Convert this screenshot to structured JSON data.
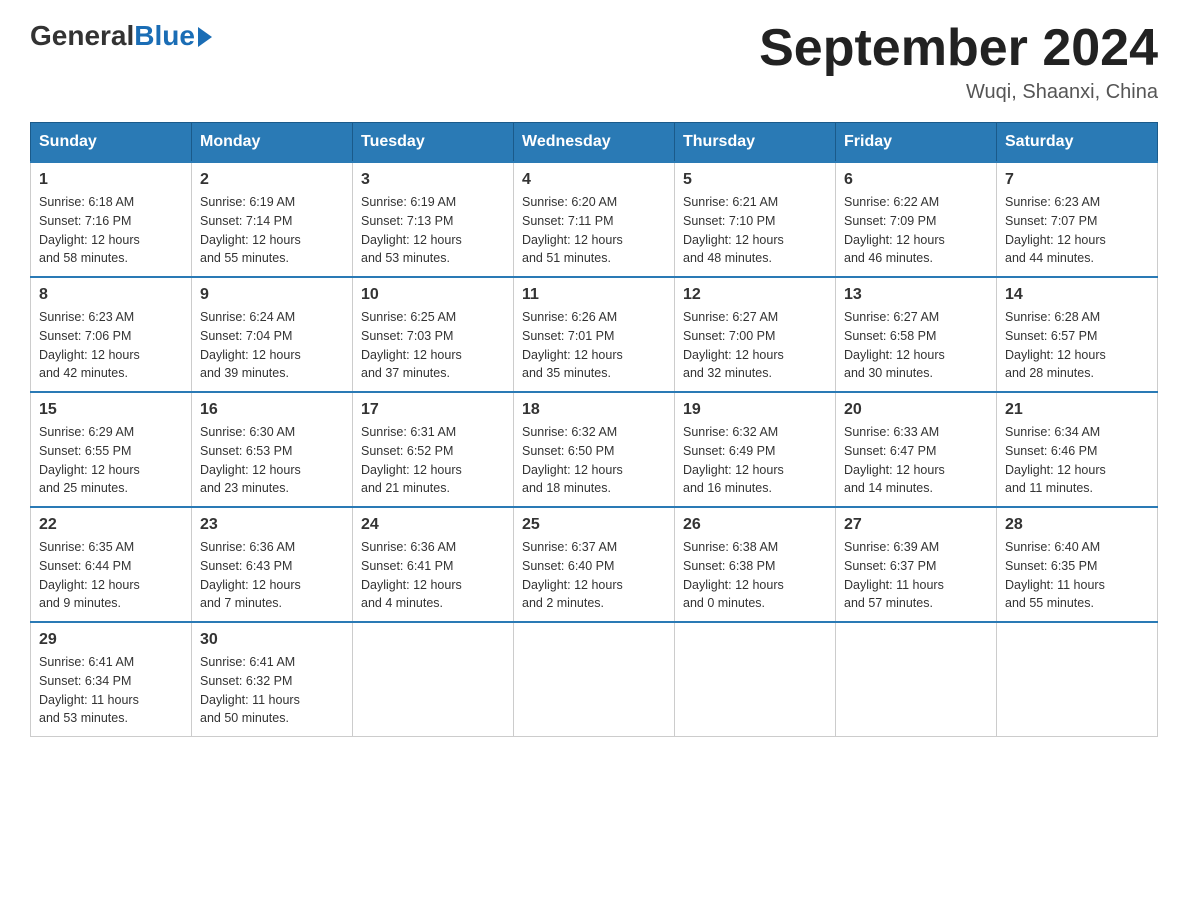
{
  "logo": {
    "general": "General",
    "blue": "Blue"
  },
  "title": "September 2024",
  "subtitle": "Wuqi, Shaanxi, China",
  "headers": [
    "Sunday",
    "Monday",
    "Tuesday",
    "Wednesday",
    "Thursday",
    "Friday",
    "Saturday"
  ],
  "weeks": [
    [
      {
        "day": "1",
        "info": "Sunrise: 6:18 AM\nSunset: 7:16 PM\nDaylight: 12 hours\nand 58 minutes."
      },
      {
        "day": "2",
        "info": "Sunrise: 6:19 AM\nSunset: 7:14 PM\nDaylight: 12 hours\nand 55 minutes."
      },
      {
        "day": "3",
        "info": "Sunrise: 6:19 AM\nSunset: 7:13 PM\nDaylight: 12 hours\nand 53 minutes."
      },
      {
        "day": "4",
        "info": "Sunrise: 6:20 AM\nSunset: 7:11 PM\nDaylight: 12 hours\nand 51 minutes."
      },
      {
        "day": "5",
        "info": "Sunrise: 6:21 AM\nSunset: 7:10 PM\nDaylight: 12 hours\nand 48 minutes."
      },
      {
        "day": "6",
        "info": "Sunrise: 6:22 AM\nSunset: 7:09 PM\nDaylight: 12 hours\nand 46 minutes."
      },
      {
        "day": "7",
        "info": "Sunrise: 6:23 AM\nSunset: 7:07 PM\nDaylight: 12 hours\nand 44 minutes."
      }
    ],
    [
      {
        "day": "8",
        "info": "Sunrise: 6:23 AM\nSunset: 7:06 PM\nDaylight: 12 hours\nand 42 minutes."
      },
      {
        "day": "9",
        "info": "Sunrise: 6:24 AM\nSunset: 7:04 PM\nDaylight: 12 hours\nand 39 minutes."
      },
      {
        "day": "10",
        "info": "Sunrise: 6:25 AM\nSunset: 7:03 PM\nDaylight: 12 hours\nand 37 minutes."
      },
      {
        "day": "11",
        "info": "Sunrise: 6:26 AM\nSunset: 7:01 PM\nDaylight: 12 hours\nand 35 minutes."
      },
      {
        "day": "12",
        "info": "Sunrise: 6:27 AM\nSunset: 7:00 PM\nDaylight: 12 hours\nand 32 minutes."
      },
      {
        "day": "13",
        "info": "Sunrise: 6:27 AM\nSunset: 6:58 PM\nDaylight: 12 hours\nand 30 minutes."
      },
      {
        "day": "14",
        "info": "Sunrise: 6:28 AM\nSunset: 6:57 PM\nDaylight: 12 hours\nand 28 minutes."
      }
    ],
    [
      {
        "day": "15",
        "info": "Sunrise: 6:29 AM\nSunset: 6:55 PM\nDaylight: 12 hours\nand 25 minutes."
      },
      {
        "day": "16",
        "info": "Sunrise: 6:30 AM\nSunset: 6:53 PM\nDaylight: 12 hours\nand 23 minutes."
      },
      {
        "day": "17",
        "info": "Sunrise: 6:31 AM\nSunset: 6:52 PM\nDaylight: 12 hours\nand 21 minutes."
      },
      {
        "day": "18",
        "info": "Sunrise: 6:32 AM\nSunset: 6:50 PM\nDaylight: 12 hours\nand 18 minutes."
      },
      {
        "day": "19",
        "info": "Sunrise: 6:32 AM\nSunset: 6:49 PM\nDaylight: 12 hours\nand 16 minutes."
      },
      {
        "day": "20",
        "info": "Sunrise: 6:33 AM\nSunset: 6:47 PM\nDaylight: 12 hours\nand 14 minutes."
      },
      {
        "day": "21",
        "info": "Sunrise: 6:34 AM\nSunset: 6:46 PM\nDaylight: 12 hours\nand 11 minutes."
      }
    ],
    [
      {
        "day": "22",
        "info": "Sunrise: 6:35 AM\nSunset: 6:44 PM\nDaylight: 12 hours\nand 9 minutes."
      },
      {
        "day": "23",
        "info": "Sunrise: 6:36 AM\nSunset: 6:43 PM\nDaylight: 12 hours\nand 7 minutes."
      },
      {
        "day": "24",
        "info": "Sunrise: 6:36 AM\nSunset: 6:41 PM\nDaylight: 12 hours\nand 4 minutes."
      },
      {
        "day": "25",
        "info": "Sunrise: 6:37 AM\nSunset: 6:40 PM\nDaylight: 12 hours\nand 2 minutes."
      },
      {
        "day": "26",
        "info": "Sunrise: 6:38 AM\nSunset: 6:38 PM\nDaylight: 12 hours\nand 0 minutes."
      },
      {
        "day": "27",
        "info": "Sunrise: 6:39 AM\nSunset: 6:37 PM\nDaylight: 11 hours\nand 57 minutes."
      },
      {
        "day": "28",
        "info": "Sunrise: 6:40 AM\nSunset: 6:35 PM\nDaylight: 11 hours\nand 55 minutes."
      }
    ],
    [
      {
        "day": "29",
        "info": "Sunrise: 6:41 AM\nSunset: 6:34 PM\nDaylight: 11 hours\nand 53 minutes."
      },
      {
        "day": "30",
        "info": "Sunrise: 6:41 AM\nSunset: 6:32 PM\nDaylight: 11 hours\nand 50 minutes."
      },
      {
        "day": "",
        "info": ""
      },
      {
        "day": "",
        "info": ""
      },
      {
        "day": "",
        "info": ""
      },
      {
        "day": "",
        "info": ""
      },
      {
        "day": "",
        "info": ""
      }
    ]
  ]
}
